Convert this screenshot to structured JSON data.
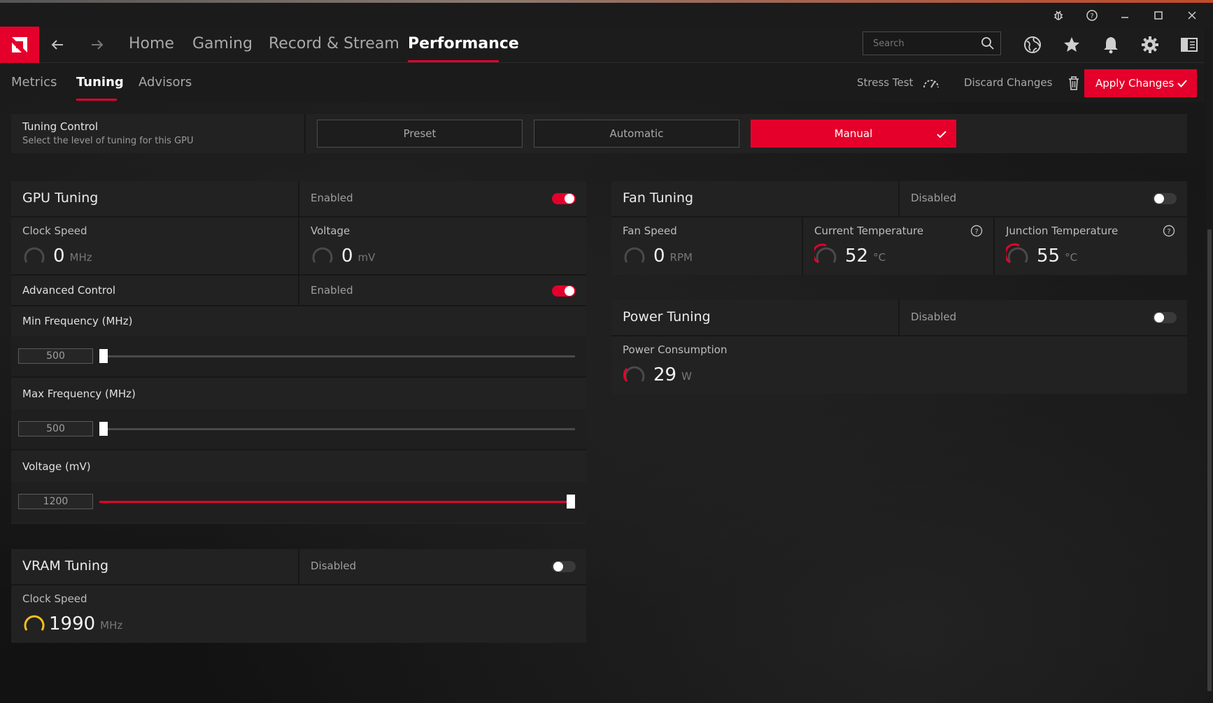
{
  "colors": {
    "accent": "#e4002b",
    "gauge_gray": "#4a4a4a",
    "gauge_yellow": "#f2c01e"
  },
  "titlebar": {
    "icons": [
      "bug-icon",
      "help-icon",
      "minimize-icon",
      "maximize-icon",
      "close-icon"
    ]
  },
  "nav": {
    "items": [
      {
        "label": "Home"
      },
      {
        "label": "Gaming"
      },
      {
        "label": "Record & Stream"
      },
      {
        "label": "Performance",
        "active": true
      }
    ],
    "search_placeholder": "Search",
    "icons": [
      "globe-icon",
      "star-icon",
      "bell-icon",
      "gear-icon",
      "sidebar-icon"
    ]
  },
  "subnav": {
    "tabs": [
      {
        "label": "Metrics"
      },
      {
        "label": "Tuning",
        "active": true
      },
      {
        "label": "Advisors"
      }
    ],
    "stress_test": "Stress Test",
    "discard": "Discard Changes",
    "apply": "Apply Changes"
  },
  "tuning_control": {
    "title": "Tuning Control",
    "subtitle": "Select the level of tuning for this GPU",
    "options": [
      {
        "label": "Preset"
      },
      {
        "label": "Automatic"
      },
      {
        "label": "Manual",
        "active": true
      }
    ]
  },
  "gpu_tuning": {
    "title": "GPU Tuning",
    "state": "Enabled",
    "enabled": true,
    "clock": {
      "label": "Clock Speed",
      "value": "0",
      "unit": "MHz"
    },
    "voltage": {
      "label": "Voltage",
      "value": "0",
      "unit": "mV"
    },
    "advanced": {
      "label": "Advanced Control",
      "state": "Enabled",
      "enabled": true
    },
    "min_freq": {
      "label": "Min Frequency (MHz)",
      "value": "500",
      "fraction": 0.0
    },
    "max_freq": {
      "label": "Max Frequency (MHz)",
      "value": "500",
      "fraction": 0.0
    },
    "volt_slider": {
      "label": "Voltage (mV)",
      "value": "1200",
      "fraction": 1.0
    }
  },
  "vram_tuning": {
    "title": "VRAM Tuning",
    "state": "Disabled",
    "enabled": false,
    "clock": {
      "label": "Clock Speed",
      "value": "1990",
      "unit": "MHz"
    }
  },
  "fan_tuning": {
    "title": "Fan Tuning",
    "state": "Disabled",
    "enabled": false,
    "fan_speed": {
      "label": "Fan Speed",
      "value": "0",
      "unit": "RPM"
    },
    "current_temp": {
      "label": "Current Temperature",
      "value": "52",
      "unit": "°C"
    },
    "junction_temp": {
      "label": "Junction Temperature",
      "value": "55",
      "unit": "°C"
    }
  },
  "power_tuning": {
    "title": "Power Tuning",
    "state": "Disabled",
    "enabled": false,
    "consumption": {
      "label": "Power Consumption",
      "value": "29",
      "unit": "W"
    }
  }
}
